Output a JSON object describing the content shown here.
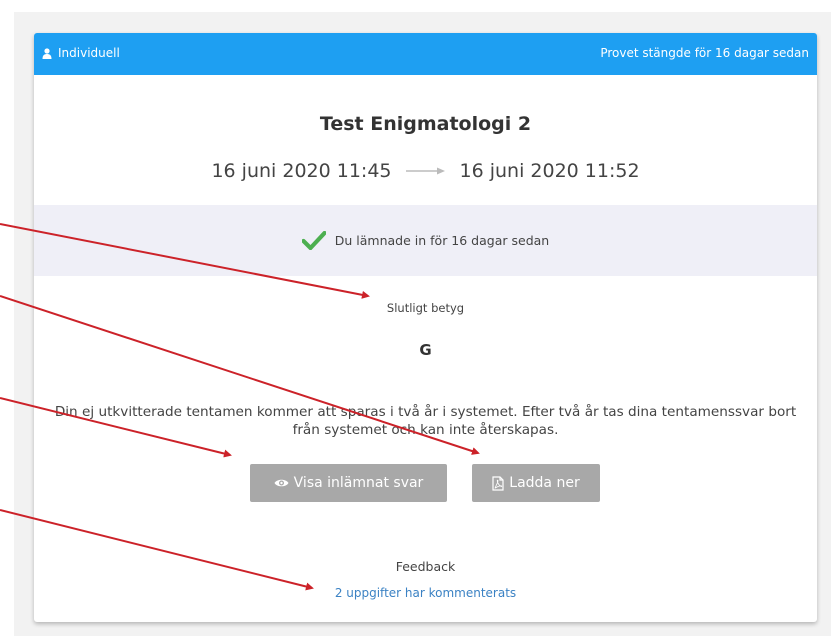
{
  "header": {
    "mode_label": "Individuell",
    "closed_status": "Provet stängde för 16 dagar sedan",
    "user_icon": "user-icon",
    "color": "#1e9ff2"
  },
  "exam": {
    "title": "Test Enigmatologi 2",
    "start": "16 juni 2020 11:45",
    "end": "16 juni 2020 11:52"
  },
  "submission": {
    "status": "Du lämnade in för 16 dagar sedan",
    "check_color": "#4caf50"
  },
  "grade": {
    "label": "Slutligt betyg",
    "value": "G"
  },
  "storage_notice": {
    "line1": "Din ej utkvitterade tentamen kommer att sparas i två år i systemet. Efter två år tas dina tentamenssvar bort",
    "line2": "från systemet och kan inte återskapas."
  },
  "buttons": {
    "view_label": "Visa inlämnat svar",
    "download_label": "Ladda ner"
  },
  "feedback": {
    "label": "Feedback",
    "link": "2 uppgifter har kommenterats"
  },
  "annotation_color": "#cc2229"
}
